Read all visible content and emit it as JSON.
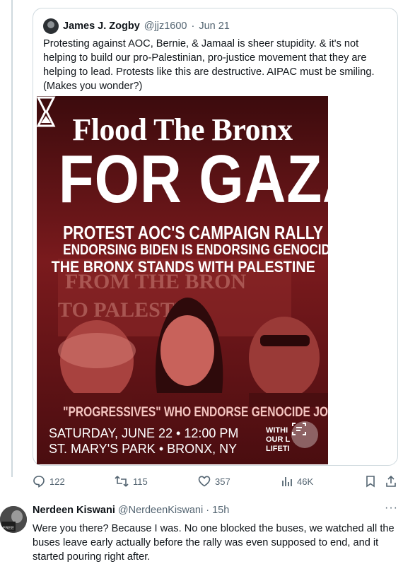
{
  "quoted_tweet": {
    "author_name": "James J. Zogby",
    "handle": "@jjz1600",
    "separator": "·",
    "date": "Jun 21",
    "text": "Protesting against AOC, Bernie, & Jamaal is sheer stupidity. & it's not helping to build our pro-Palestinian, pro-justice movement that they are helping to lead. Protests like this are destructive. AIPAC must be smiling. (Makes you wonder?)",
    "poster": {
      "title_line1": "Flood The Bronx",
      "title_line2": "FOR GAZA",
      "line1": "PROTEST AOC'S CAMPAIGN RALLY",
      "line2": "ENDORSING BIDEN IS ENDORSING GENOCIDE",
      "line3": "THE BRONX STANDS WITH PALESTINE",
      "caption": "\"PROGRESSIVES\" WHO ENDORSE GENOCIDE JOE",
      "date_time": "SATURDAY, JUNE 22 • 12:00 PM",
      "location": "ST. MARY'S PARK • BRONX, NY",
      "logo_text_1": "WITHI",
      "logo_text_2": "OUR L",
      "logo_text_3": "LIFETI"
    }
  },
  "actions": {
    "replies": "122",
    "reposts": "115",
    "likes": "357",
    "views": "46K"
  },
  "reply": {
    "author_name": "Nerdeen Kiswani",
    "handle": "@NerdeenKiswani",
    "separator": "·",
    "time": "15h",
    "more": "···",
    "text": "Were you there? Because I was. No one blocked the buses, we watched all the buses leave early actually before the rally was even supposed to end, and it started pouring right after."
  },
  "colors": {
    "muted": "#536471",
    "border": "#cfd9de",
    "poster_red": "#6b1418"
  },
  "icons": [
    "reply-icon",
    "repost-icon",
    "like-icon",
    "views-icon",
    "bookmark-icon",
    "share-icon",
    "lens-icon",
    "more-icon"
  ]
}
